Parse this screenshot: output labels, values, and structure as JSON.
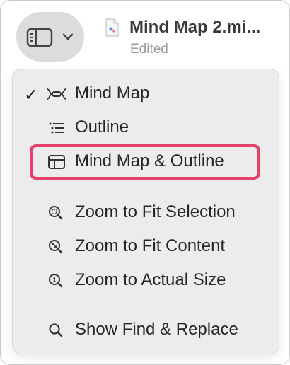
{
  "toolbar": {
    "sidebar_toggle_icon": "sidebar-icon",
    "chevron_icon": "chevron-down-icon",
    "document_icon": "document-icon",
    "document_title": "Mind Map 2.mi...",
    "document_status": "Edited"
  },
  "menu": {
    "items": [
      {
        "label": "Mind Map",
        "icon": "mind-map-icon",
        "checked": true
      },
      {
        "label": "Outline",
        "icon": "outline-icon",
        "checked": false
      },
      {
        "label": "Mind Map & Outline",
        "icon": "mind-map-outline-icon",
        "checked": false,
        "highlighted": true
      },
      {
        "label": "Zoom to Fit Selection",
        "icon": "zoom-fit-selection-icon"
      },
      {
        "label": "Zoom to Fit Content",
        "icon": "zoom-fit-content-icon"
      },
      {
        "label": "Zoom to Actual Size",
        "icon": "zoom-actual-size-icon"
      },
      {
        "label": "Show Find & Replace",
        "icon": "search-icon"
      }
    ],
    "check_mark": "✓"
  },
  "colors": {
    "highlight_border": "#e4416b",
    "menu_background": "#ececec",
    "toggle_background": "#dcdcdc"
  }
}
